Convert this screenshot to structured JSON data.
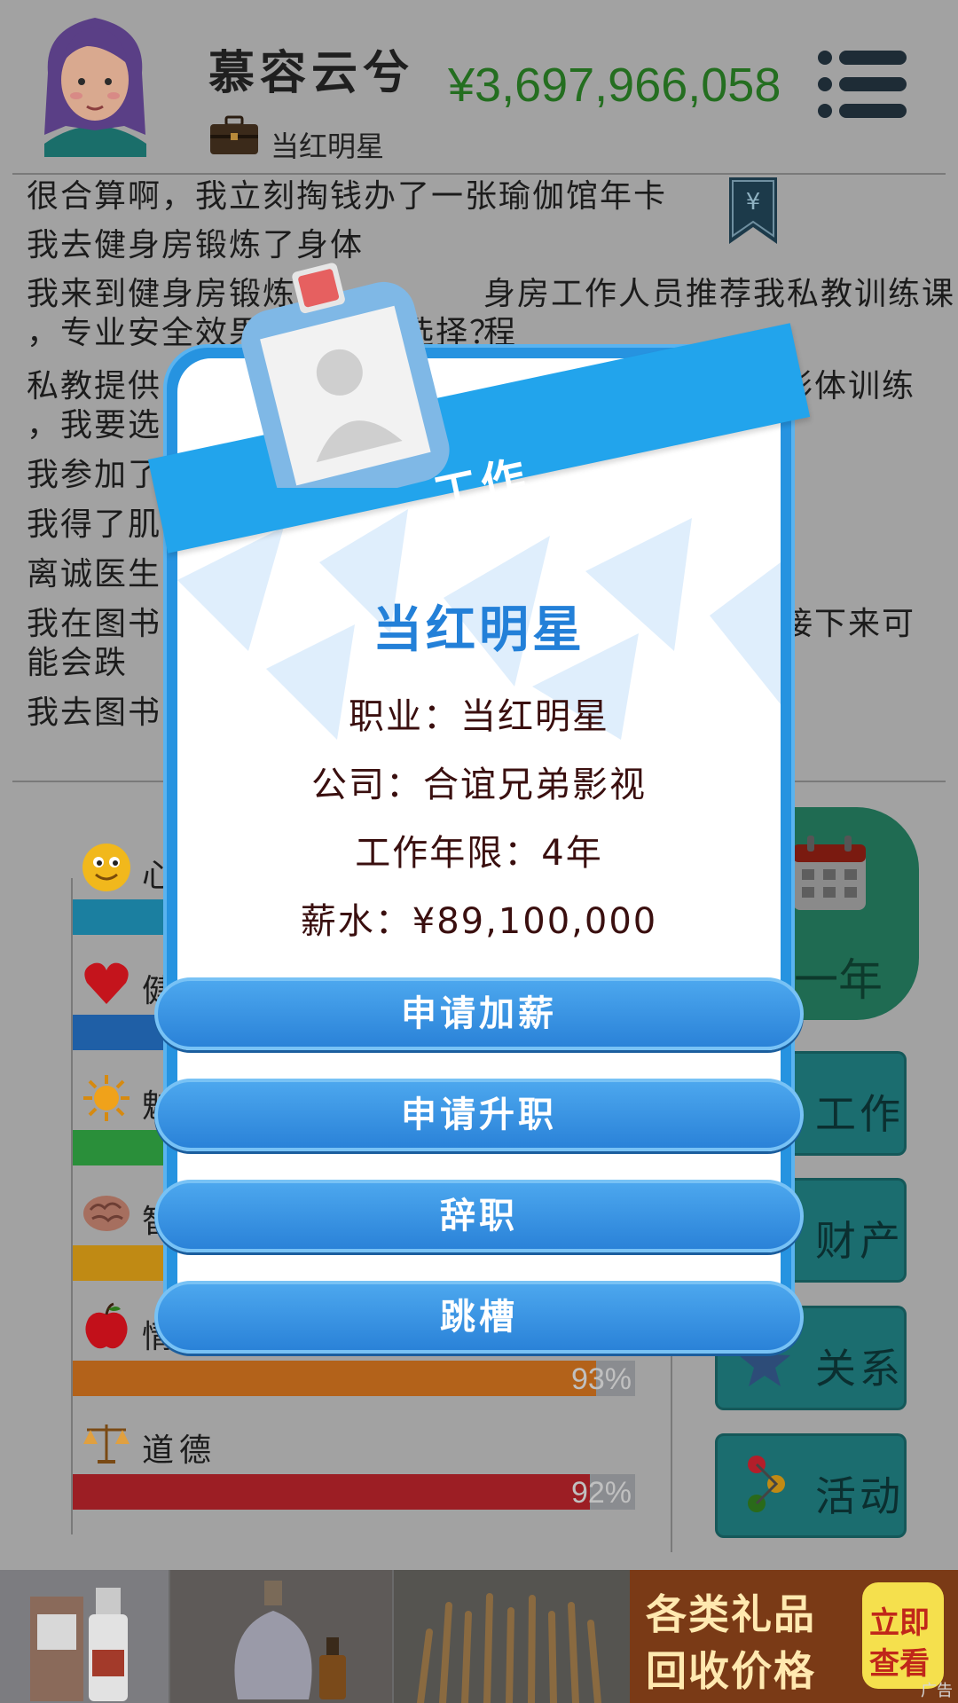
{
  "header": {
    "player_name": "慕容云兮",
    "job_title": "当红明星",
    "money": "¥3,697,966,058"
  },
  "log": {
    "lines": [
      "很合算啊，我立刻掏钱办了一张瑜伽馆年卡",
      "我去健身房锻炼了身体",
      "我来到健身房锻炼",
      "身房工作人员推荐我私教训练课程",
      "，专业安全效果",
      "么选择？",
      "私教提供",
      "形体训练",
      "，我要选",
      "我参加了",
      "我得了肌",
      "离诚医生",
      "我在图书",
      "接下来可",
      "能会跌",
      "我去图书"
    ]
  },
  "stats": {
    "items": [
      {
        "label": "心",
        "percent": null,
        "color": "#1b7fa0"
      },
      {
        "label": "健",
        "percent": null,
        "color": "#1f5fa6"
      },
      {
        "label": "魅",
        "percent": null,
        "color": "#2a8f3a"
      },
      {
        "label": "智",
        "percent": null,
        "color": "#c08a14"
      },
      {
        "label": "情",
        "percent_text": "93%",
        "percent": 0.93,
        "color": "#b3621a"
      },
      {
        "label": "道德",
        "percent_text": "92%",
        "percent": 0.92,
        "color": "#9c1e24"
      }
    ]
  },
  "side_buttons": {
    "year": "一年",
    "work": "工作",
    "assets": "财产",
    "relations": "关系",
    "activities": "活动"
  },
  "modal": {
    "ribbon_title": "工作",
    "job_name": "当红明星",
    "occupation": "职业：当红明星",
    "company": "公司：合谊兄弟影视",
    "years": "工作年限：4年",
    "salary": "薪水：¥89,100,000",
    "buttons": {
      "raise": "申请加薪",
      "promote": "申请升职",
      "resign": "辞职",
      "switch": "跳槽"
    }
  },
  "ad": {
    "headline_1": "各类礼品",
    "headline_2": "回收价格",
    "badge_1": "立即",
    "badge_2": "查看",
    "tag": "广告"
  }
}
